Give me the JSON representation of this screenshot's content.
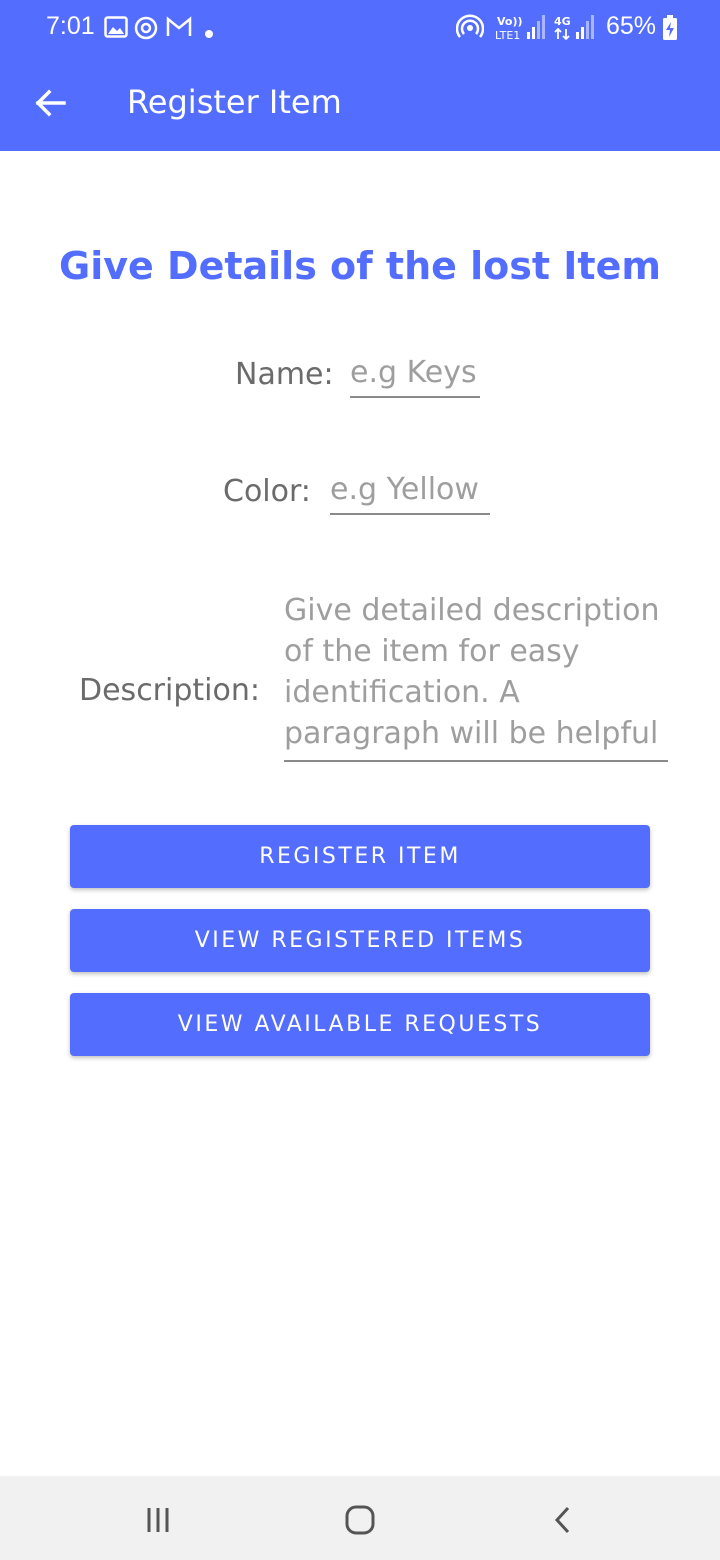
{
  "status_bar": {
    "time": "7:01",
    "battery_percent": "65%",
    "icons": [
      "gallery-icon",
      "sync-icon",
      "gmail-icon",
      "dot-icon",
      "hotspot-icon",
      "volte-signal-icon",
      "4g-signal-icon",
      "battery-icon"
    ],
    "volte_label": "Vo)) LTE1",
    "net_label": "4G"
  },
  "app_bar": {
    "title": "Register Item",
    "back_icon": "arrow-left-icon",
    "color": "#536dfe"
  },
  "form": {
    "heading": "Give Details of the lost Item",
    "name": {
      "label": "Name:",
      "placeholder": "e.g Keys"
    },
    "color": {
      "label": "Color:",
      "placeholder": "e.g Yellow"
    },
    "description": {
      "label": "Description:",
      "placeholder": "Give detailed description of the item for easy identification. A paragraph will be helpful"
    }
  },
  "buttons": {
    "register": "REGISTER ITEM",
    "view_registered": "VIEW REGISTERED ITEMS",
    "view_requests": "VIEW AVAILABLE REQUESTS"
  },
  "nav_bar": {
    "icons": [
      "recent-apps-icon",
      "home-icon",
      "back-icon"
    ]
  }
}
